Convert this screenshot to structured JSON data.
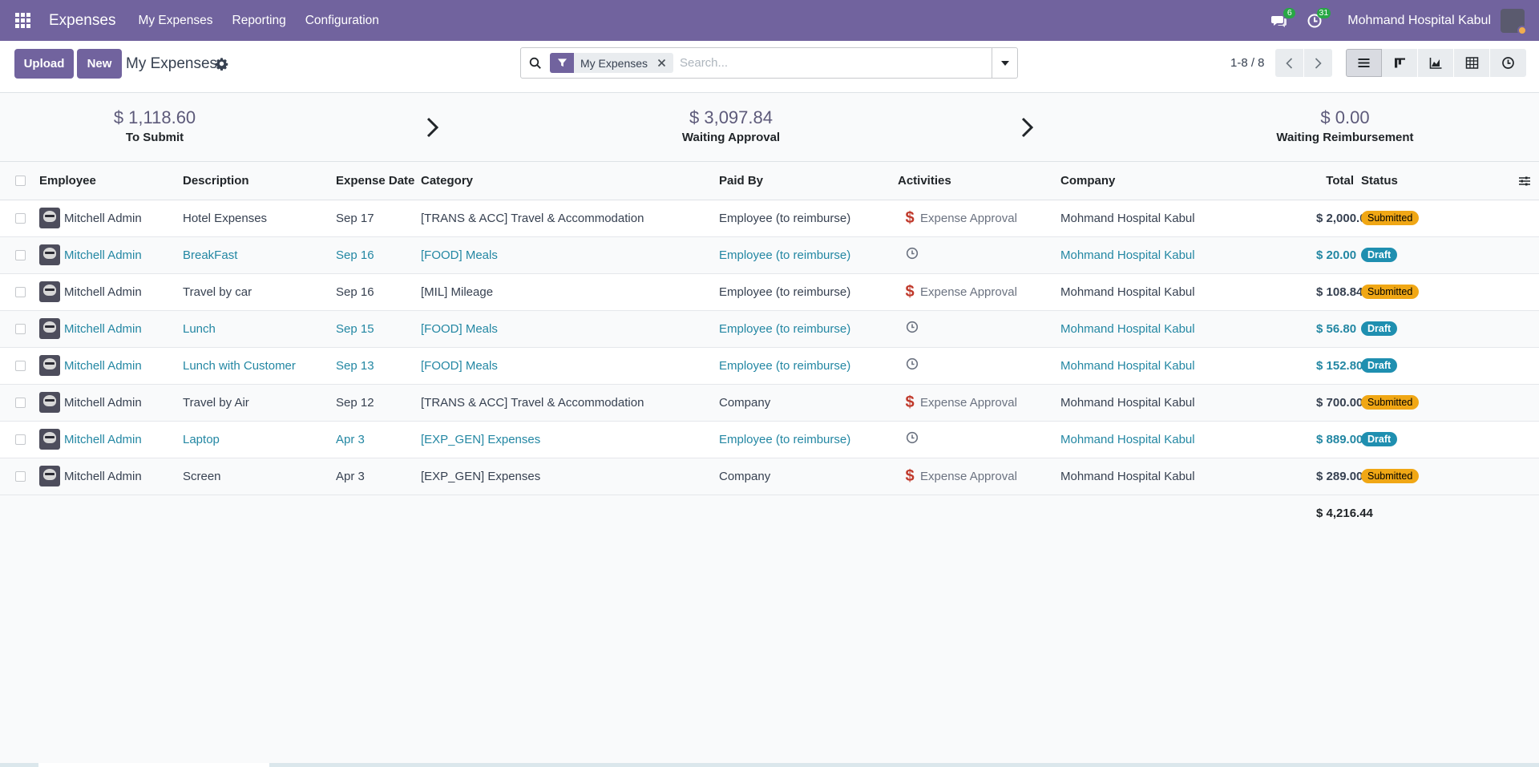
{
  "navbar": {
    "app_name": "Expenses",
    "menus": [
      "My Expenses",
      "Reporting",
      "Configuration"
    ],
    "messages_count": "6",
    "activities_count": "31",
    "company": "Mohmand Hospital Kabul"
  },
  "control": {
    "upload_label": "Upload",
    "new_label": "New",
    "title": "My Expenses",
    "facet_label": "My Expenses",
    "search_placeholder": "Search...",
    "pager": "1-8 / 8"
  },
  "summary": {
    "to_submit_amount": "$ 1,118.60",
    "to_submit_label": "To Submit",
    "waiting_approval_amount": "$ 3,097.84",
    "waiting_approval_label": "Waiting Approval",
    "waiting_reimbursement_amount": "$ 0.00",
    "waiting_reimbursement_label": "Waiting Reimbursement"
  },
  "table": {
    "headers": {
      "employee": "Employee",
      "description": "Description",
      "date": "Expense Date",
      "category": "Category",
      "paid_by": "Paid By",
      "activities": "Activities",
      "company": "Company",
      "total": "Total",
      "status": "Status"
    },
    "rows": [
      {
        "employee": "Mitchell Admin",
        "description": "Hotel Expenses",
        "date": "Sep 17",
        "category": "[TRANS & ACC] Travel & Accommodation",
        "paid_by": "Employee (to reimburse)",
        "activity": "Expense Approval",
        "company": "Mohmand Hospital Kabul",
        "total": "$ 2,000.00",
        "status": "Submitted"
      },
      {
        "employee": "Mitchell Admin",
        "description": "BreakFast",
        "date": "Sep 16",
        "category": "[FOOD] Meals",
        "paid_by": "Employee (to reimburse)",
        "activity": "",
        "company": "Mohmand Hospital Kabul",
        "total": "$ 20.00",
        "status": "Draft"
      },
      {
        "employee": "Mitchell Admin",
        "description": "Travel by car",
        "date": "Sep 16",
        "category": "[MIL] Mileage",
        "paid_by": "Employee (to reimburse)",
        "activity": "Expense Approval",
        "company": "Mohmand Hospital Kabul",
        "total": "$ 108.84",
        "status": "Submitted"
      },
      {
        "employee": "Mitchell Admin",
        "description": "Lunch",
        "date": "Sep 15",
        "category": "[FOOD] Meals",
        "paid_by": "Employee (to reimburse)",
        "activity": "",
        "company": "Mohmand Hospital Kabul",
        "total": "$ 56.80",
        "status": "Draft"
      },
      {
        "employee": "Mitchell Admin",
        "description": "Lunch with Customer",
        "date": "Sep 13",
        "category": "[FOOD] Meals",
        "paid_by": "Employee (to reimburse)",
        "activity": "",
        "company": "Mohmand Hospital Kabul",
        "total": "$ 152.80",
        "status": "Draft"
      },
      {
        "employee": "Mitchell Admin",
        "description": "Travel by Air",
        "date": "Sep 12",
        "category": "[TRANS & ACC] Travel & Accommodation",
        "paid_by": "Company",
        "activity": "Expense Approval",
        "company": "Mohmand Hospital Kabul",
        "total": "$ 700.00",
        "status": "Submitted"
      },
      {
        "employee": "Mitchell Admin",
        "description": "Laptop",
        "date": "Apr 3",
        "category": "[EXP_GEN] Expenses",
        "paid_by": "Employee (to reimburse)",
        "activity": "",
        "company": "Mohmand Hospital Kabul",
        "total": "$ 889.00",
        "status": "Draft"
      },
      {
        "employee": "Mitchell Admin",
        "description": "Screen",
        "date": "Apr 3",
        "category": "[EXP_GEN] Expenses",
        "paid_by": "Company",
        "activity": "Expense Approval",
        "company": "Mohmand Hospital Kabul",
        "total": "$ 289.00",
        "status": "Submitted"
      }
    ],
    "grand_total": "$ 4,216.44"
  },
  "colors": {
    "brand": "#71639e",
    "link": "#2387a3",
    "submitted": "#f0a715",
    "draft": "#1f8fb0",
    "activity_dollar": "#c0392b"
  },
  "icons": {
    "apps": "apps-grid-icon",
    "messages": "chat-icon",
    "activities": "clock-icon",
    "settings": "gear-icon",
    "search": "search-icon",
    "filter": "filter-icon",
    "views": [
      "list-view-icon",
      "kanban-view-icon",
      "graph-view-icon",
      "pivot-view-icon",
      "activity-view-icon"
    ]
  }
}
